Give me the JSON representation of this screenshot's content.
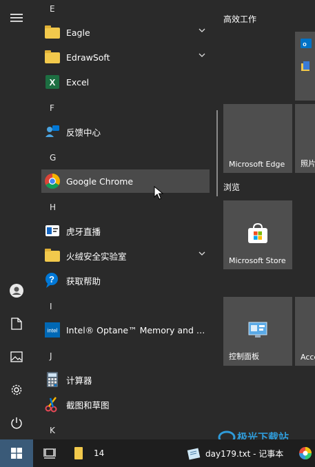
{
  "app_list": {
    "sections": [
      {
        "letter": "E"
      },
      {
        "letter": "F"
      },
      {
        "letter": "G"
      },
      {
        "letter": "H"
      },
      {
        "letter": "I"
      },
      {
        "letter": "J"
      },
      {
        "letter": "K"
      }
    ],
    "items": [
      {
        "label": "Eagle",
        "icon": "folder-icon",
        "expandable": true
      },
      {
        "label": "EdrawSoft",
        "icon": "folder-icon",
        "expandable": true
      },
      {
        "label": "Excel",
        "icon": "excel-icon",
        "expandable": false
      },
      {
        "label": "反馈中心",
        "icon": "feedback-hub-icon",
        "expandable": false
      },
      {
        "label": "Google Chrome",
        "icon": "chrome-icon",
        "expandable": false,
        "hovered": true
      },
      {
        "label": "虎牙直播",
        "icon": "huya-icon",
        "expandable": false
      },
      {
        "label": "火绒安全实验室",
        "icon": "folder-icon",
        "expandable": true
      },
      {
        "label": "获取帮助",
        "icon": "get-help-icon",
        "expandable": false
      },
      {
        "label": "Intel® Optane™ Memory and Stor...",
        "icon": "intel-icon",
        "expandable": false
      },
      {
        "label": "计算器",
        "icon": "calculator-icon",
        "expandable": false
      },
      {
        "label": "截图和草图",
        "icon": "snip-sketch-icon",
        "expandable": false
      }
    ]
  },
  "tiles": {
    "group1_title": "高效工作",
    "group2_title": "浏览",
    "edge_label": "Microsoft Edge",
    "photos_label": "照片",
    "store_label": "Microsoft Store",
    "control_panel_label": "控制面板",
    "access_label": "Acce"
  },
  "taskbar": {
    "folder_count": "14",
    "notepad_label": "day179.txt - 记事本"
  },
  "watermark": {
    "text": "极光下载站"
  },
  "colors": {
    "accent": "#0078d7",
    "folder": "#f2c94c",
    "tile_bg": "#4e4e4e",
    "start_bg": "#2a2a2a"
  }
}
